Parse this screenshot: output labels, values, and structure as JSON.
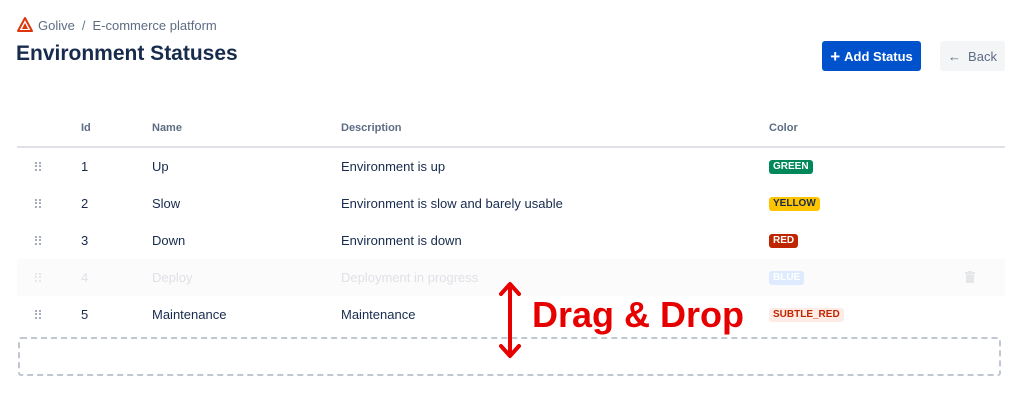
{
  "breadcrumb": {
    "root": "Golive",
    "separator": "/",
    "current": "E-commerce platform"
  },
  "page_title": "Environment Statuses",
  "actions": {
    "add_label": "Add Status",
    "back_label": "Back"
  },
  "table": {
    "headers": {
      "id": "Id",
      "name": "Name",
      "description": "Description",
      "color": "Color"
    },
    "rows": [
      {
        "id": "1",
        "name": "Up",
        "description": "Environment is up",
        "color_label": "GREEN",
        "bg": "#00875a",
        "fg": "#ffffff",
        "dragging": false
      },
      {
        "id": "2",
        "name": "Slow",
        "description": "Environment is slow and barely usable",
        "color_label": "YELLOW",
        "bg": "#ffc400",
        "fg": "#172b4d",
        "dragging": false
      },
      {
        "id": "3",
        "name": "Down",
        "description": "Environment is down",
        "color_label": "RED",
        "bg": "#bf2600",
        "fg": "#ffffff",
        "dragging": false
      },
      {
        "id": "4",
        "name": "Deploy",
        "description": "Deployment in progress",
        "color_label": "BLUE",
        "bg": "#deebff",
        "fg": "#ffffff",
        "dragging": true
      },
      {
        "id": "5",
        "name": "Maintenance",
        "description": "Maintenance",
        "color_label": "SUBTLE_RED",
        "bg": "#ffebe6",
        "fg": "#bf2600",
        "dragging": false
      }
    ]
  },
  "annotation": {
    "text": "Drag & Drop"
  },
  "colors": {
    "primary": "#0052cc",
    "annotation": "#e60000",
    "logo": "#de350b"
  }
}
